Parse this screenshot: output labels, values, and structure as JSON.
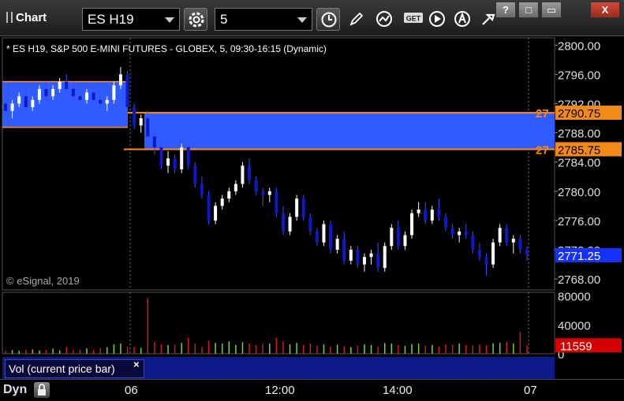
{
  "toolbar": {
    "title": "Chart",
    "symbol": "ES H19",
    "interval": "5",
    "buttons": [
      "settings-icon",
      "clock-icon",
      "pencil-icon",
      "studies-icon",
      "get-icon",
      "play-icon",
      "alert-icon",
      "tools-icon"
    ],
    "get_label": "GET",
    "window_buttons": [
      "?",
      "□",
      "X"
    ]
  },
  "chart": {
    "subtitle": "* ES H19, S&P 500 E-MINI FUTURES - GLOBEX, 5, 09:30-16:15 (Dynamic)",
    "watermark": "© eSignal, 2019",
    "price_ticks": [
      "2800.00",
      "2796.00",
      "2792.00",
      "2788.00",
      "2784.00",
      "2780.00",
      "2776.00",
      "2772.00",
      "2768.00"
    ],
    "price_tick_values": [
      2800,
      2796,
      2792,
      2788,
      2784,
      2780,
      2776,
      2772,
      2768
    ],
    "price_range": [
      2766.5,
      2801
    ],
    "last_price": "2771.25",
    "level_high": "2790.75",
    "level_low": "2785.75",
    "level_high_value": 2790.75,
    "level_low_value": 2785.75,
    "level_left_label": "27",
    "zone_prev": {
      "high": 2795.0,
      "low": 2788.75
    },
    "zone_colors": {
      "fill": "#2f5bff",
      "line": "#ff8c1a",
      "candle_up": "#ffffff",
      "candle_down": "#0a1ac8",
      "last_price_bg": "#1530ff"
    },
    "x_ticks": [
      "06",
      "12:00",
      "14:00",
      "07"
    ],
    "candles": [
      [
        2792.0,
        2793.5,
        2790.5,
        2791.0
      ],
      [
        2791.0,
        2792.5,
        2790.0,
        2792.0
      ],
      [
        2792.0,
        2793.5,
        2791.5,
        2793.0
      ],
      [
        2793.0,
        2794.0,
        2791.0,
        2791.5
      ],
      [
        2791.5,
        2793.0,
        2791.0,
        2792.5
      ],
      [
        2792.5,
        2794.5,
        2792.0,
        2794.0
      ],
      [
        2794.0,
        2795.0,
        2792.5,
        2793.0
      ],
      [
        2793.0,
        2794.5,
        2792.5,
        2794.0
      ],
      [
        2794.0,
        2795.5,
        2793.5,
        2795.0
      ],
      [
        2795.0,
        2796.0,
        2793.5,
        2794.0
      ],
      [
        2794.0,
        2795.0,
        2792.5,
        2793.0
      ],
      [
        2793.0,
        2794.0,
        2792.0,
        2792.5
      ],
      [
        2792.5,
        2794.0,
        2792.0,
        2793.5
      ],
      [
        2793.5,
        2794.5,
        2792.0,
        2792.5
      ],
      [
        2792.5,
        2793.5,
        2791.5,
        2792.0
      ],
      [
        2792.0,
        2793.0,
        2791.0,
        2792.5
      ],
      [
        2792.5,
        2795.0,
        2792.0,
        2794.5
      ],
      [
        2794.5,
        2797.0,
        2794.0,
        2796.0
      ],
      [
        2796.0,
        2796.5,
        2791.0,
        2791.5
      ],
      [
        2791.5,
        2792.0,
        2788.5,
        2789.0
      ],
      [
        2789.0,
        2790.5,
        2788.0,
        2790.0
      ],
      [
        2790.0,
        2791.0,
        2787.0,
        2787.5
      ],
      [
        2787.5,
        2788.5,
        2785.0,
        2786.0
      ],
      [
        2786.0,
        2787.0,
        2783.0,
        2783.5
      ],
      [
        2783.5,
        2785.5,
        2782.5,
        2784.5
      ],
      [
        2784.5,
        2785.0,
        2782.5,
        2783.0
      ],
      [
        2783.0,
        2786.5,
        2782.5,
        2786.0
      ],
      [
        2786.0,
        2786.5,
        2783.0,
        2783.5
      ],
      [
        2783.5,
        2784.0,
        2780.5,
        2781.0
      ],
      [
        2781.0,
        2782.0,
        2779.0,
        2779.5
      ],
      [
        2779.5,
        2780.0,
        2775.5,
        2776.0
      ],
      [
        2776.0,
        2778.5,
        2775.5,
        2778.0
      ],
      [
        2778.0,
        2779.5,
        2777.5,
        2779.0
      ],
      [
        2779.0,
        2780.5,
        2778.5,
        2780.0
      ],
      [
        2780.0,
        2781.5,
        2779.5,
        2781.0
      ],
      [
        2781.0,
        2784.0,
        2780.5,
        2783.5
      ],
      [
        2783.5,
        2784.5,
        2781.0,
        2781.5
      ],
      [
        2781.5,
        2782.0,
        2779.5,
        2780.0
      ],
      [
        2780.0,
        2780.5,
        2778.0,
        2779.5
      ],
      [
        2779.5,
        2780.5,
        2778.5,
        2780.0
      ],
      [
        2780.0,
        2780.5,
        2776.5,
        2777.0
      ],
      [
        2777.0,
        2778.0,
        2774.0,
        2774.5
      ],
      [
        2774.5,
        2777.0,
        2774.0,
        2776.5
      ],
      [
        2776.5,
        2779.5,
        2776.0,
        2779.0
      ],
      [
        2779.0,
        2779.5,
        2776.0,
        2776.5
      ],
      [
        2776.5,
        2777.0,
        2774.0,
        2774.5
      ],
      [
        2774.5,
        2775.0,
        2772.5,
        2773.0
      ],
      [
        2773.0,
        2776.0,
        2772.5,
        2775.5
      ],
      [
        2775.5,
        2776.0,
        2771.5,
        2772.0
      ],
      [
        2772.0,
        2774.0,
        2771.5,
        2773.5
      ],
      [
        2773.5,
        2774.5,
        2770.0,
        2770.5
      ],
      [
        2770.5,
        2772.5,
        2770.0,
        2772.0
      ],
      [
        2772.0,
        2772.5,
        2769.5,
        2770.0
      ],
      [
        2770.0,
        2771.5,
        2769.0,
        2771.0
      ],
      [
        2771.0,
        2772.0,
        2770.0,
        2771.5
      ],
      [
        2771.5,
        2773.0,
        2769.0,
        2769.5
      ],
      [
        2769.5,
        2773.0,
        2769.0,
        2772.5
      ],
      [
        2772.5,
        2775.5,
        2772.0,
        2775.0
      ],
      [
        2775.0,
        2776.0,
        2772.0,
        2772.5
      ],
      [
        2772.5,
        2774.5,
        2772.0,
        2774.0
      ],
      [
        2774.0,
        2777.5,
        2773.5,
        2777.0
      ],
      [
        2777.0,
        2778.5,
        2776.5,
        2777.5
      ],
      [
        2777.5,
        2778.5,
        2775.5,
        2776.0
      ],
      [
        2776.0,
        2778.0,
        2775.5,
        2777.5
      ],
      [
        2777.5,
        2779.0,
        2776.0,
        2776.5
      ],
      [
        2776.5,
        2777.0,
        2774.5,
        2775.0
      ],
      [
        2775.0,
        2775.5,
        2773.5,
        2774.0
      ],
      [
        2774.0,
        2775.0,
        2773.0,
        2774.5
      ],
      [
        2774.5,
        2775.5,
        2773.5,
        2774.0
      ],
      [
        2774.0,
        2774.5,
        2771.5,
        2772.0
      ],
      [
        2772.0,
        2773.0,
        2770.5,
        2771.0
      ],
      [
        2771.0,
        2771.5,
        2768.5,
        2770.0
      ],
      [
        2770.0,
        2773.5,
        2769.5,
        2773.0
      ],
      [
        2773.0,
        2775.5,
        2772.5,
        2775.0
      ],
      [
        2775.0,
        2775.5,
        2772.5,
        2773.0
      ],
      [
        2773.0,
        2774.0,
        2771.5,
        2773.5
      ],
      [
        2773.5,
        2774.0,
        2771.5,
        2772.0
      ],
      [
        2772.0,
        2772.5,
        2770.5,
        2771.25
      ]
    ],
    "vol_ticks": [
      "80000",
      "40000",
      "0"
    ],
    "vol_tick_values": [
      80000,
      40000,
      0
    ],
    "vol_max": 85000,
    "vol_last": "11559",
    "vol_last_bg": "#d40000",
    "vol_label": "Vol (current price bar)",
    "vol_close_glyph": "×",
    "volumes": [
      4000,
      5000,
      4200,
      5500,
      6000,
      4500,
      5200,
      7000,
      4800,
      9000,
      5600,
      6000,
      7500,
      5000,
      8200,
      9000,
      13000,
      14000,
      10000,
      9000,
      8000,
      77000,
      16000,
      13000,
      12000,
      12500,
      15000,
      22000,
      14000,
      9000,
      18000,
      15000,
      14000,
      17000,
      12000,
      16000,
      14500,
      12000,
      13500,
      14000,
      22000,
      17000,
      13000,
      15000,
      12000,
      14000,
      11000,
      13000,
      10000,
      12500,
      10500,
      9000,
      11000,
      13000,
      12000,
      10000,
      15000,
      14000,
      12000,
      11000,
      13500,
      14000,
      11500,
      12000,
      10000,
      13000,
      12500,
      14000,
      12000,
      11500,
      13000,
      12000,
      14500,
      15000,
      16000,
      14000,
      30000,
      11559
    ],
    "vol_up_color": "#7fd22a",
    "vol_down_color": "#d41a1a"
  },
  "status": {
    "dyn": "Dyn"
  }
}
